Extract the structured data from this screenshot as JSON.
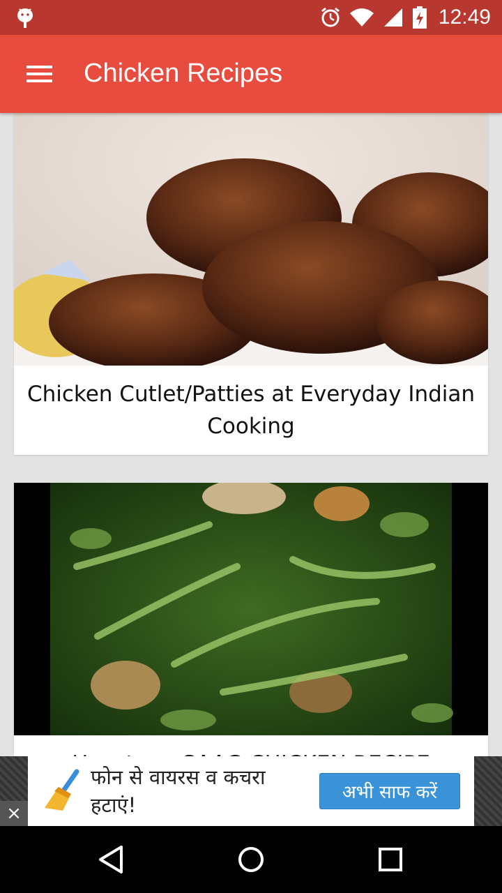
{
  "status_bar": {
    "time": "12:49",
    "icons": [
      "android-icon",
      "alarm-icon",
      "wifi-icon",
      "signal-icon",
      "battery-icon"
    ]
  },
  "toolbar": {
    "title": "Chicken Recipes",
    "menu_icon": "hamburger-menu-icon",
    "color": "#e74c3f"
  },
  "feed": {
    "cards": [
      {
        "title": "Chicken Cutlet/Patties at Everyday Indian Cooking",
        "image": "chicken-cutlets-photo"
      },
      {
        "title": "How to ... SAAG CHICKEN RECIPE",
        "image": "saag-chicken-photo"
      }
    ]
  },
  "ad": {
    "text": "फोन से वायरस व कचरा हटाएं!",
    "cta": "अभी साफ करें",
    "icon": "broom-cleaner-icon",
    "close": "×"
  },
  "nav_bar": {
    "buttons": [
      "back-icon",
      "home-icon",
      "recents-icon"
    ]
  }
}
